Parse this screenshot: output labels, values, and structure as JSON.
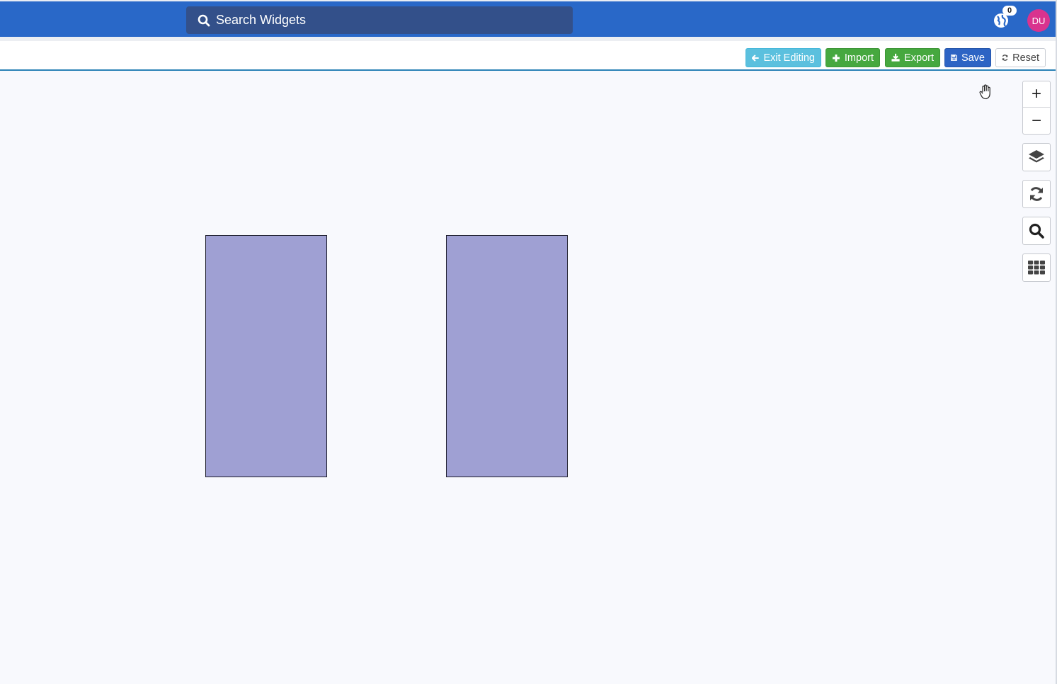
{
  "header": {
    "search_placeholder": "Search Widgets",
    "search_icon": "search-icon",
    "notification_icon": "globe-icon",
    "notification_count": "0",
    "user_initials": "DU",
    "colors": {
      "bar": "#2968c8",
      "search_bg": "#33508a",
      "avatar": "#d9338e"
    }
  },
  "toolbar": {
    "exit_label": "Exit Editing",
    "import_label": "Import",
    "export_label": "Export",
    "save_label": "Save",
    "reset_label": "Reset",
    "icons": [
      "arrow-left-icon",
      "plus-icon",
      "download-icon",
      "floppy-disk-icon",
      "refresh-icon"
    ],
    "colors": {
      "exit": "#5bc0de",
      "import": "#46a83f",
      "export": "#46a83f",
      "save": "#2d64c4"
    }
  },
  "map_controls": {
    "zoom_in": "+",
    "zoom_out": "−",
    "icons": [
      "layers-icon",
      "refresh-icon",
      "search-icon",
      "grid-icon"
    ]
  },
  "canvas": {
    "shape_color": "#9fa0d3",
    "cursor_icon": "hand-pointer-icon"
  }
}
